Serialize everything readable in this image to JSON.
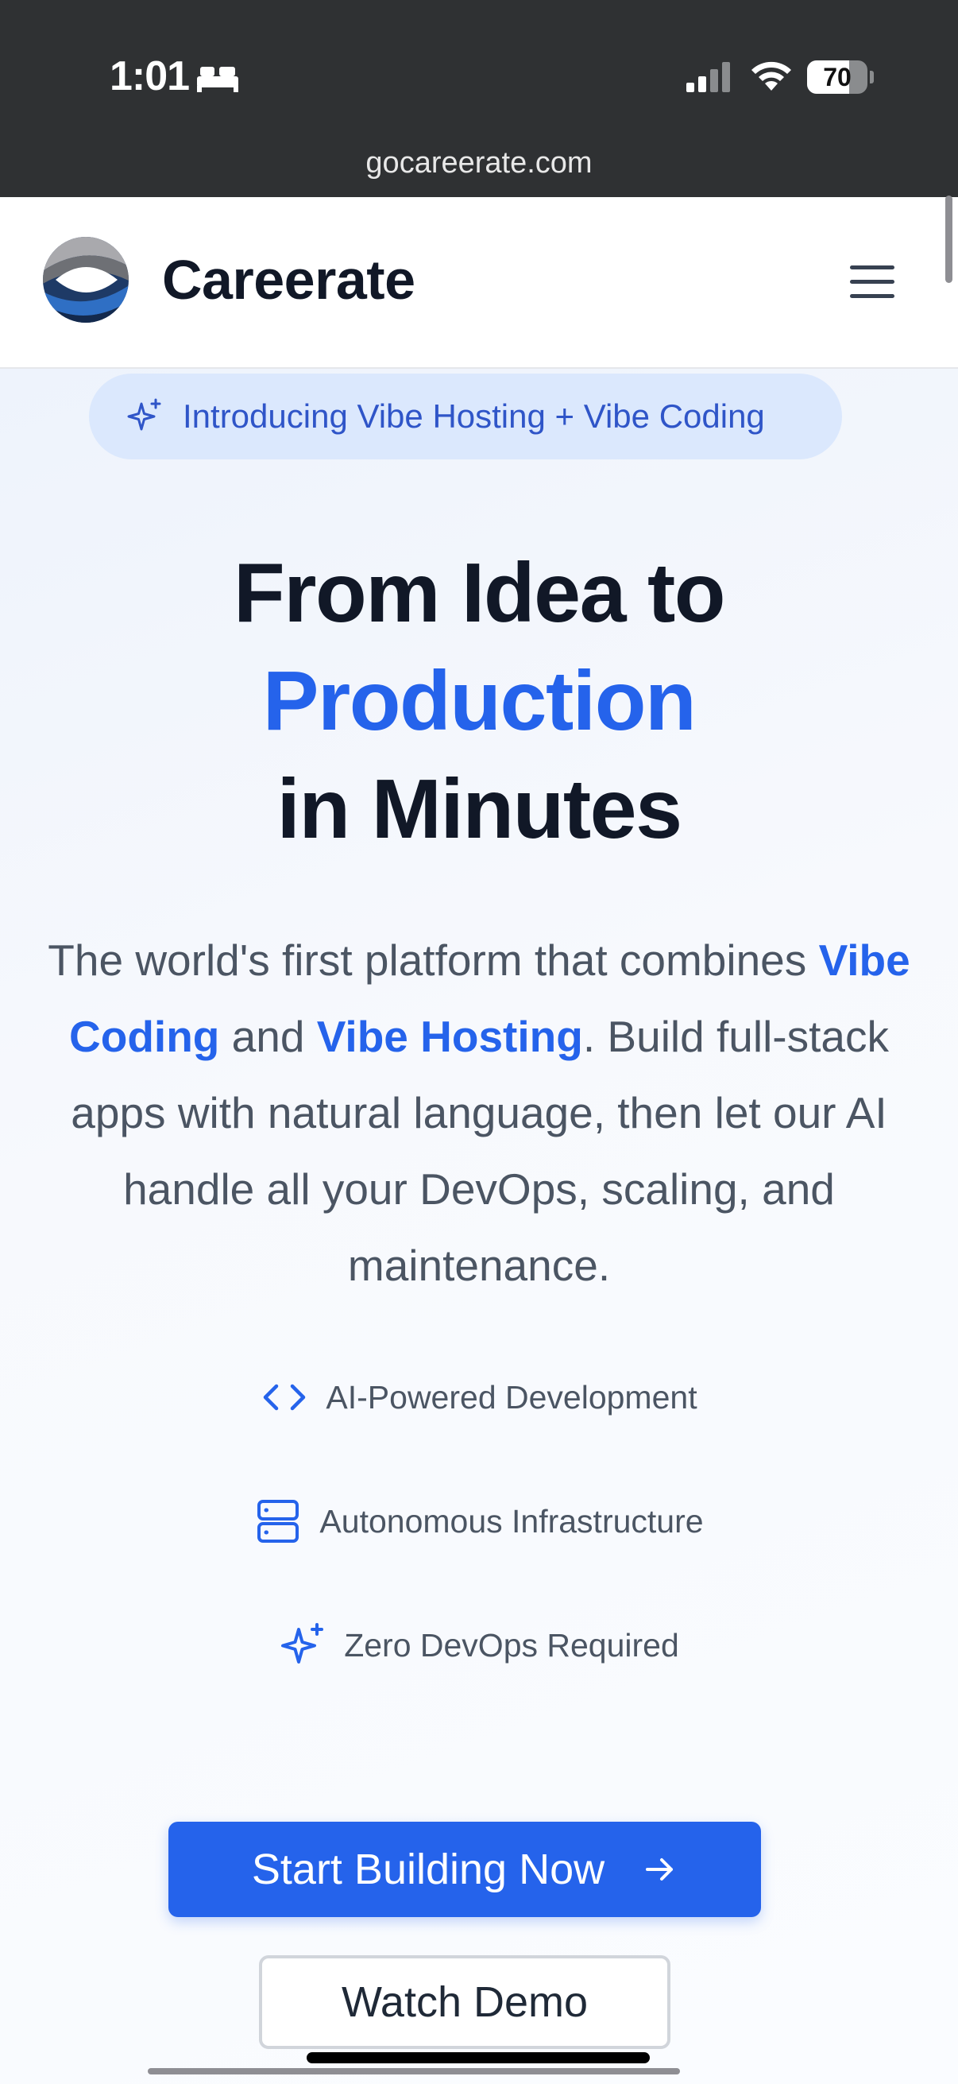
{
  "status_bar": {
    "time": "1:01",
    "battery": "70",
    "battery_level": 0.7,
    "icons": [
      "bed-icon",
      "cellular-signal-icon",
      "wifi-icon",
      "battery-icon"
    ]
  },
  "browser": {
    "url": "gocareerate.com"
  },
  "nav": {
    "brand": "Careerate",
    "logo_icon": "careerate-logo",
    "menu_icon": "hamburger-menu-icon"
  },
  "hero": {
    "badge": {
      "icon": "sparkles-icon",
      "text": "Introducing Vibe Hosting + Vibe Coding"
    },
    "headline": {
      "line1": "From Idea to",
      "line2": "Production",
      "line3": "in Minutes"
    },
    "subtext": {
      "part1": "The world's first platform that combines ",
      "highlight1": "Vibe Coding",
      "part2": " and ",
      "highlight2": "Vibe Hosting",
      "part3": ". Build full-stack apps with natural language, then let our AI handle all your DevOps, scaling, and maintenance."
    },
    "features": [
      {
        "icon": "code-icon",
        "label": "AI-Powered Development"
      },
      {
        "icon": "server-icon",
        "label": "Autonomous Infrastructure"
      },
      {
        "icon": "sparkles-icon",
        "label": "Zero DevOps Required"
      }
    ],
    "cta_primary": {
      "label": "Start Building Now",
      "icon": "arrow-right-icon"
    },
    "cta_secondary": {
      "label": "Watch Demo"
    }
  },
  "colors": {
    "accent": "#2563eb",
    "badge_bg": "#dbe8fd",
    "status_bar_bg": "#2f3133",
    "text_dark": "#111827",
    "text_muted": "#4b5563"
  }
}
